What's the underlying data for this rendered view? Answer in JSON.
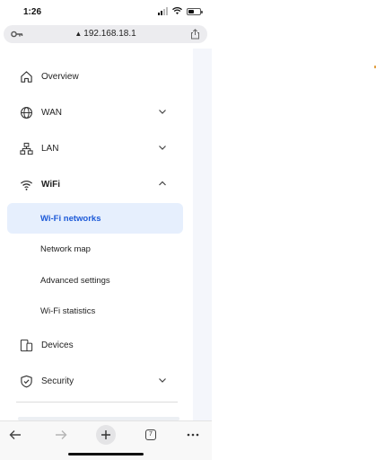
{
  "status_bar": {
    "time": "1:26"
  },
  "browser": {
    "url": "192.168.18.1",
    "tab_count": "7"
  },
  "nav": {
    "overview": "Overview",
    "wan": "WAN",
    "lan": "LAN",
    "wifi": "WiFi",
    "wifi_sub": [
      "Wi-Fi networks",
      "Network map",
      "Advanced settings",
      "Wi-Fi statistics"
    ],
    "devices": "Devices",
    "security": "Security"
  },
  "colors": {
    "active_bg": "#e6effd",
    "active_text": "#1d5ad8",
    "page_bg": "#f4f6fb"
  },
  "icons": {
    "overview": "home-icon",
    "wan": "globe-icon",
    "lan": "network-icon",
    "wifi": "wifi-icon",
    "devices": "devices-icon",
    "security": "shield-icon"
  }
}
